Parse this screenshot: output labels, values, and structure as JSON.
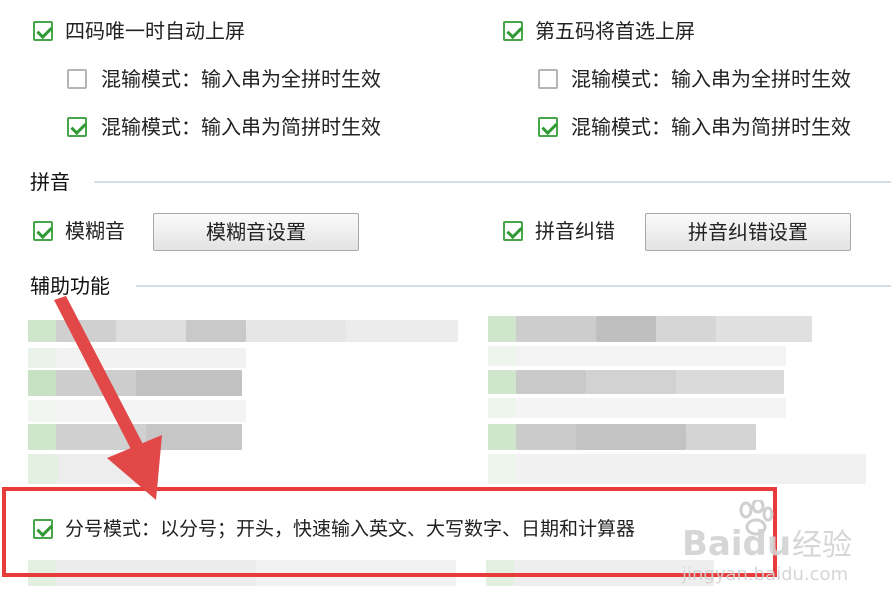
{
  "row1": {
    "left": {
      "label": "四码唯一时自动上屏",
      "checked": true
    },
    "right": {
      "label": "第五码将首选上屏",
      "checked": true
    }
  },
  "row2": {
    "left": {
      "label": "混输模式：输入串为全拼时生效",
      "checked": false
    },
    "right": {
      "label": "混输模式：输入串为全拼时生效",
      "checked": false
    }
  },
  "row3": {
    "left": {
      "label": "混输模式：输入串为简拼时生效",
      "checked": true
    },
    "right": {
      "label": "混输模式：输入串为简拼时生效",
      "checked": true
    }
  },
  "pinyin": {
    "section_title": "拼音",
    "fuzzy": {
      "label": "模糊音",
      "checked": true,
      "button_label": "模糊音设置"
    },
    "correction": {
      "label": "拼音纠错",
      "checked": true,
      "button_label": "拼音纠错设置"
    }
  },
  "aux": {
    "section_title": "辅助功能",
    "semicolon_mode": {
      "label": "分号模式：以分号；开头，快速输入英文、大写数字、日期和计算器",
      "checked": true
    }
  },
  "watermark": {
    "brand_bai": "Bai",
    "brand_du": "du",
    "brand_cn": "经验",
    "url": "jingyan.baidu.com"
  },
  "colors": {
    "checkbox_green": "#47a649",
    "highlight_red": "#e83b3b",
    "arrow_red": "#e24848"
  }
}
